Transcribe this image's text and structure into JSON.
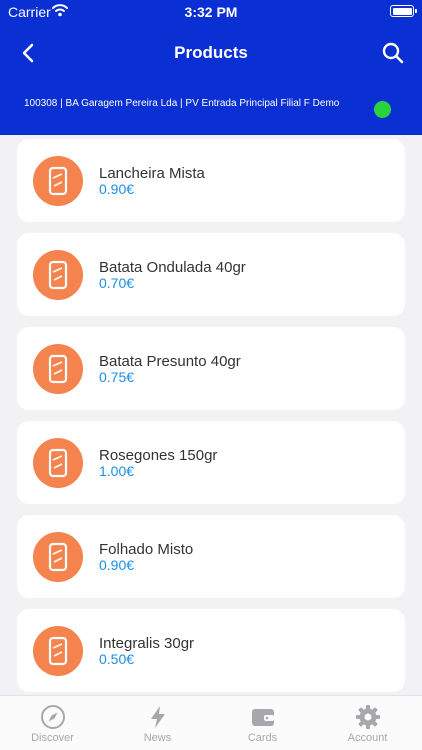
{
  "status_bar": {
    "carrier": "Carrier",
    "time": "3:32 PM"
  },
  "header": {
    "title": "Products",
    "store_info": "100308 | BA Garagem Pereira  Lda | PV Entrada Principal Filial F Demo",
    "status_color": "#28d33f",
    "background_color": "#0a2fd3"
  },
  "products": [
    {
      "name": "Lancheira Mista",
      "price": "0.90€"
    },
    {
      "name": "Batata Ondulada 40gr",
      "price": "0.70€"
    },
    {
      "name": "Batata Presunto 40gr",
      "price": "0.75€"
    },
    {
      "name": "Rosegones 150gr",
      "price": "1.00€"
    },
    {
      "name": "Folhado Misto",
      "price": "0.90€"
    },
    {
      "name": "Integralis 30gr",
      "price": "0.50€"
    }
  ],
  "tabbar": {
    "tabs": [
      {
        "label": "Discover",
        "icon": "compass-icon"
      },
      {
        "label": "News",
        "icon": "lightning-icon"
      },
      {
        "label": "Cards",
        "icon": "wallet-icon"
      },
      {
        "label": "Account",
        "icon": "gear-icon"
      }
    ]
  }
}
